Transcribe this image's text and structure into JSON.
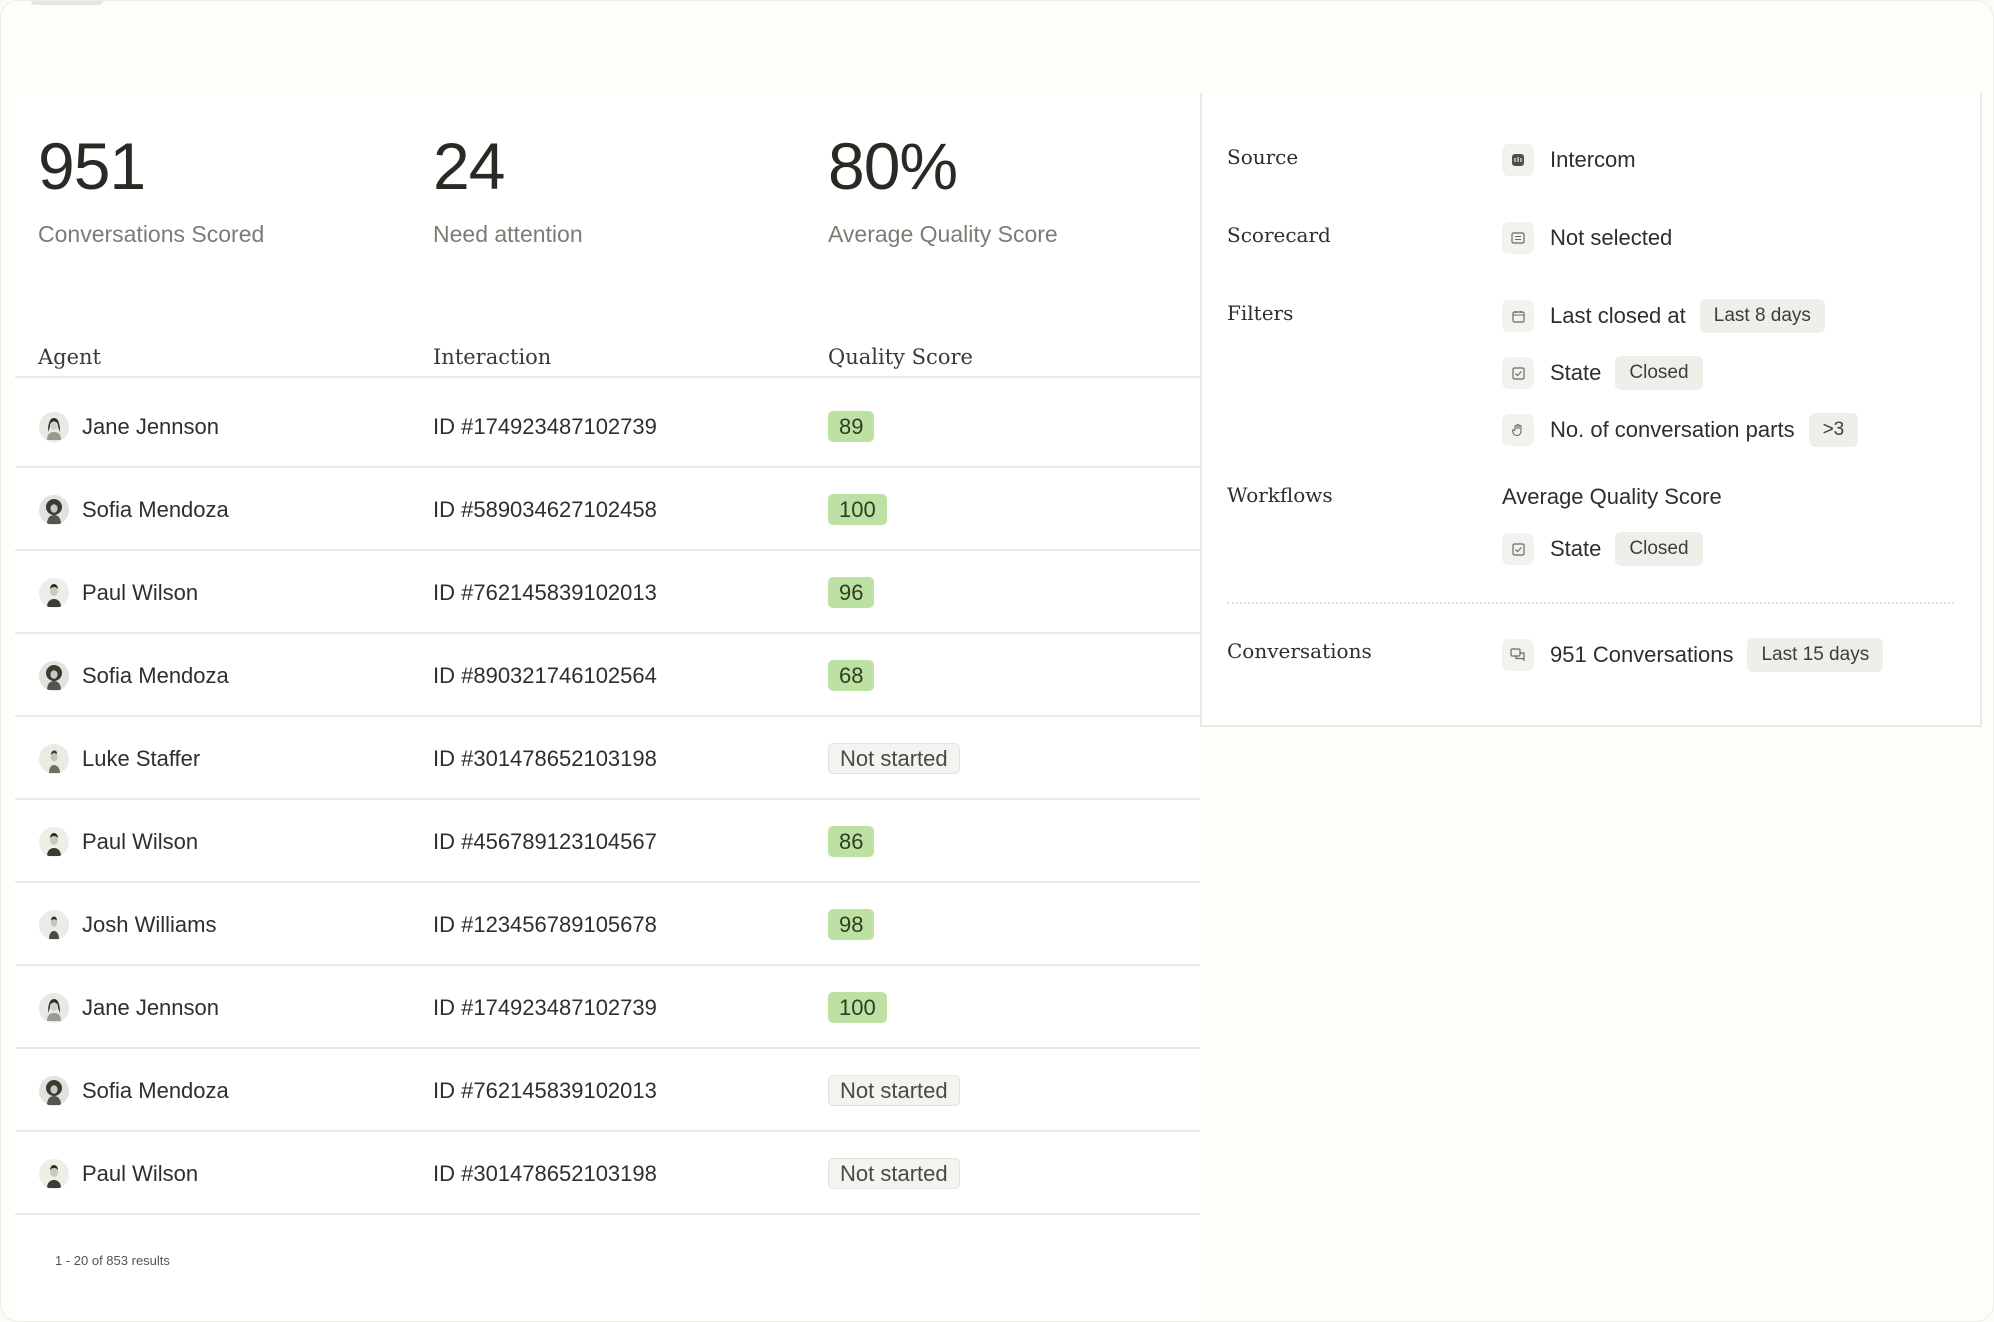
{
  "stats": [
    {
      "value": "951",
      "label": "Conversations Scored"
    },
    {
      "value": "24",
      "label": "Need attention"
    },
    {
      "value": "80%",
      "label": "Average Quality Score"
    }
  ],
  "table": {
    "headers": {
      "agent": "Agent",
      "interaction": "Interaction",
      "score": "Quality Score"
    },
    "rows": [
      {
        "agent": "Jane Jennson",
        "interaction": "ID #174923487102739",
        "score": "89",
        "status": "scored",
        "avatar": "woman-long-hair-avatar"
      },
      {
        "agent": "Sofia Mendoza",
        "interaction": "ID #589034627102458",
        "score": "100",
        "status": "scored",
        "avatar": "woman-curly-hair-avatar"
      },
      {
        "agent": "Paul Wilson",
        "interaction": "ID #762145839102013",
        "score": "96",
        "status": "scored",
        "avatar": "man-short-hair-avatar"
      },
      {
        "agent": "Sofia Mendoza",
        "interaction": "ID #890321746102564",
        "score": "68",
        "status": "scored",
        "avatar": "woman-curly-hair-avatar"
      },
      {
        "agent": "Luke Staffer",
        "interaction": "ID #301478652103198",
        "score": "Not started",
        "status": "pending",
        "avatar": "man-side-profile-avatar"
      },
      {
        "agent": "Paul Wilson",
        "interaction": "ID #456789123104567",
        "score": "86",
        "status": "scored",
        "avatar": "man-short-hair-avatar"
      },
      {
        "agent": "Josh Williams",
        "interaction": "ID #123456789105678",
        "score": "98",
        "status": "scored",
        "avatar": "man-slim-avatar"
      },
      {
        "agent": "Jane Jennson",
        "interaction": "ID #174923487102739",
        "score": "100",
        "status": "scored",
        "avatar": "woman-long-hair-avatar"
      },
      {
        "agent": "Sofia Mendoza",
        "interaction": "ID #762145839102013",
        "score": "Not started",
        "status": "pending",
        "avatar": "woman-curly-hair-avatar"
      },
      {
        "agent": "Paul Wilson",
        "interaction": "ID #301478652103198",
        "score": "Not started",
        "status": "pending",
        "avatar": "man-short-hair-avatar"
      }
    ]
  },
  "pagination": {
    "text": "1 - 20 of 853 results"
  },
  "panel": {
    "source": {
      "label": "Source",
      "value": "Intercom",
      "icon": "intercom-icon"
    },
    "scorecard": {
      "label": "Scorecard",
      "value": "Not selected",
      "icon": "scorecard-icon"
    },
    "filters": {
      "label": "Filters",
      "items": [
        {
          "name": "Last closed at",
          "chip": "Last 8 days",
          "icon": "calendar-icon"
        },
        {
          "name": "State",
          "chip": "Closed",
          "icon": "checkbox-icon"
        },
        {
          "name": "No. of conversation parts",
          "chip": ">3",
          "icon": "hand-icon"
        }
      ]
    },
    "workflows": {
      "label": "Workflows",
      "title": "Average Quality Score",
      "item": {
        "name": "State",
        "chip": "Closed",
        "icon": "checkbox-icon"
      }
    },
    "conversations": {
      "label": "Conversations",
      "value": "951 Conversations",
      "chip": "Last 15 days",
      "icon": "chat-icon"
    }
  },
  "colors": {
    "score_badge_bg": "#bde1a3",
    "pending_badge_bg": "#f3f3ef",
    "page_bg": "#fdfdfa"
  }
}
